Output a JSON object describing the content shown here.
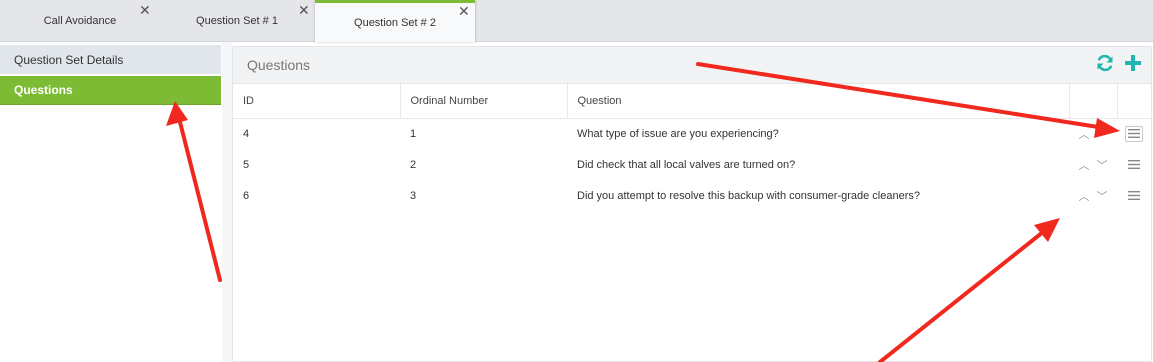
{
  "tabs": [
    {
      "label": "Call Avoidance",
      "close": "✕"
    },
    {
      "label": "Question Set # 1",
      "close": "✕"
    },
    {
      "label": "Question Set # 2",
      "close": "✕"
    }
  ],
  "sidebar": {
    "items": [
      {
        "label": "Question Set Details"
      },
      {
        "label": "Questions"
      }
    ]
  },
  "panel": {
    "title": "Questions",
    "icons": [
      "refresh-icon",
      "plus-icon"
    ]
  },
  "table": {
    "columns": [
      "ID",
      "Ordinal Number",
      "Question"
    ],
    "rows": [
      {
        "id": "4",
        "ordinal": "1",
        "question": "What type of issue are you experiencing?"
      },
      {
        "id": "5",
        "ordinal": "2",
        "question": "Did check that all local valves are turned on?"
      },
      {
        "id": "6",
        "ordinal": "3",
        "question": "Did you attempt to resolve this backup with consumer-grade cleaners?"
      }
    ],
    "up_glyph": "︿",
    "down_glyph": "﹀"
  },
  "colors": {
    "accent_green": "#7dbb35",
    "icon_teal": "#1fb6b0",
    "annotation_red": "#f0281e"
  }
}
